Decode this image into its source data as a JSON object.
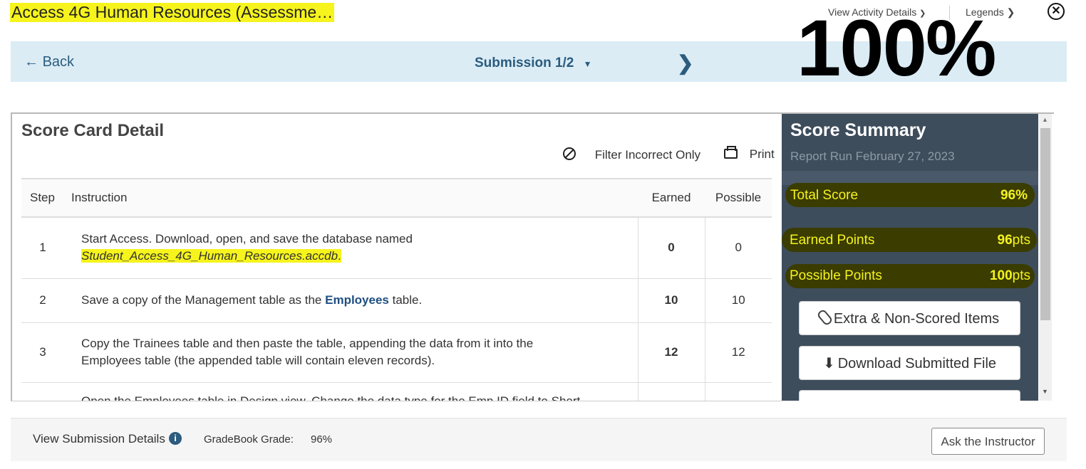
{
  "header": {
    "title": "Access 4G Human Resources (Assessme…",
    "view_activity": "View Activity Details",
    "legends": "Legends",
    "close_icon": "close-icon"
  },
  "nav": {
    "back": "Back",
    "submission": "Submission 1/2",
    "score_overlay": "100%"
  },
  "scorecard": {
    "title": "Score Card Detail",
    "filter": "Filter Incorrect Only",
    "print": "Print",
    "columns": [
      "Step",
      "Instruction",
      "Earned",
      "Possible"
    ],
    "rows": [
      {
        "step": "1",
        "text": "Start Access. Download, open, and save the database named",
        "file": "Student_Access_4G_Human_Resources.accdb",
        "earned": "0",
        "possible": "0"
      },
      {
        "step": "2",
        "text_before": "Save a copy of the Management table as the ",
        "emph": "Employees",
        "text_after": " table.",
        "earned": "10",
        "possible": "10"
      },
      {
        "step": "3",
        "line1": "Copy the Trainees table and then paste the table, appending the data from it into the",
        "line2": "Employees table (the appended table will contain eleven records).",
        "earned": "12",
        "possible": "12"
      },
      {
        "step": "",
        "text": "Open the Employees table in Design view. Change the data type for the Emp ID field to Short",
        "earned": "",
        "possible": ""
      }
    ]
  },
  "summary": {
    "title": "Score Summary",
    "report_run": "Report Run February 27, 2023",
    "total_label": "Total Score",
    "total_value": "96%",
    "earned_label": "Earned Points",
    "earned_num": "96",
    "earned_unit": "pts",
    "possible_label": "Possible Points",
    "possible_num": "100",
    "possible_unit": "pts",
    "btn_extra": "Extra & Non-Scored Items",
    "btn_download": "Download Submitted File"
  },
  "footer": {
    "view_details": "View Submission Details",
    "gradebook_label": "GradeBook Grade:",
    "gradebook_value": "96%",
    "ask": "Ask the Instructor"
  }
}
